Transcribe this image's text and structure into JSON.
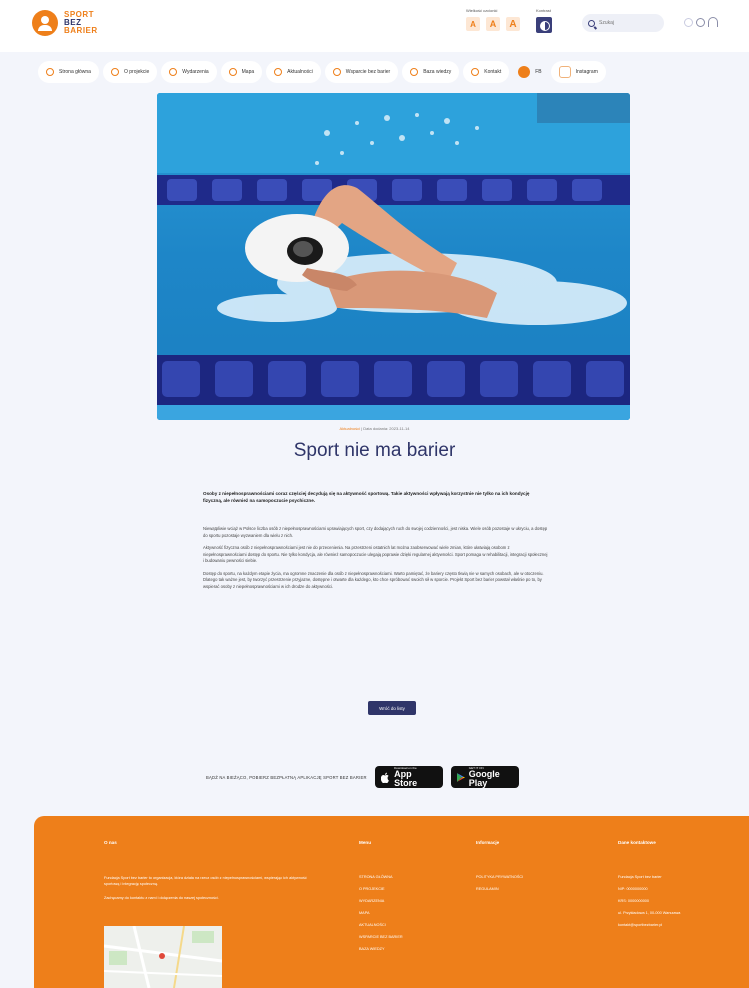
{
  "header": {
    "logo": {
      "line1": "SPORT",
      "line2": "BEZ",
      "line3": "BARIER"
    },
    "font_size_label": "Wielkość czcionki",
    "font_buttons": [
      "A",
      "A",
      "A"
    ],
    "contrast_label": "Kontrast",
    "search_placeholder": "Szukaj"
  },
  "nav": {
    "items": [
      "Strona główna",
      "O projekcie",
      "Wydarzenia",
      "Mapa",
      "Aktualności",
      "Wsparcie bez barier",
      "Baza wiedzy",
      "Kontakt",
      "FB",
      "Instagram"
    ]
  },
  "article": {
    "category": "Aktualności",
    "date": "Data dodania: 2023-11-14",
    "title": "Sport nie ma barier",
    "lead": "Osoby z niepełnosprawnościami coraz częściej decydują się na aktywność sportową. Takie aktywności wpływają korzystnie nie tylko na ich kondycję fizyczną, ale również na samopoczucie psychiczne.",
    "paragraphs": [
      "Niewątpliwie wciąż w Polsce liczba osób z niepełnosprawnościami uprawiających sport, czy dodających ruch do swojej codzienności, jest niska. Wiele osób pozostaje w ukryciu, a dostęp do sportu pozostaje wyzwaniem dla wielu z nich.",
      "Aktywność fizyczna osób z niepełnosprawnościami jest nie do przecenienia. Na przestrzeni ostatnich lat można zaobserwować wiele zmian, które ułatwiają osobom z niepełnosprawnościami dostęp do sportu. Nie tylko kondycja, ale również samopoczucie ulegają poprawie dzięki regularnej aktywności. Sport pomaga w rehabilitacji, integracji społecznej i budowaniu pewności siebie.",
      "Dostęp do sportu, na każdym etapie życia, ma ogromne znaczenie dla osób z niepełnosprawnościami. Warto pamiętać, że bariery często tkwią nie w samych osobach, ale w otoczeniu. Dlatego tak ważne jest, by tworzyć przestrzenie przyjazne, dostępne i otwarte dla każdego, kto chce spróbować swoich sił w sporcie. Projekt Sport bez barier powstał właśnie po to, by wspierać osoby z niepełnosprawnościami w ich drodze do aktywności."
    ],
    "back_button": "Wróć do listy"
  },
  "apps": {
    "text": "BĄDŹ NA BIEŻĄCO, POBIERZ BEZPŁATNĄ APLIKACJĘ SPORT BEZ BARIER",
    "apple_small": "Download on the",
    "apple_big": "App Store",
    "google_small": "GET IT ON",
    "google_big": "Google Play"
  },
  "footer": {
    "about_title": "O nas",
    "about_text_1": "Fundacja Sport bez barier to organizacja, która działa na rzecz osób z niepełnosprawnościami, wspierając ich aktywność sportową i integrację społeczną.",
    "about_text_2": "Zachęcamy do kontaktu z nami i dołączenia do naszej społeczności.",
    "menu_title": "Menu",
    "menu_items": [
      "STRONA GŁÓWNA",
      "O PROJEKCIE",
      "WYDARZENIA",
      "MAPA",
      "AKTUALNOŚCI",
      "WSPARCIE BEZ BARIER",
      "BAZA WIEDZY"
    ],
    "info_title": "Informacje",
    "info_items": [
      "POLITYKA PRYWATNOŚCI",
      "REGULAMIN"
    ],
    "contact_title": "Dane kontaktowe",
    "contact_items": [
      "Fundacja Sport bez barier",
      "NIP: 0000000000",
      "KRS: 0000000000",
      "ul. Przykładowa 1, 00-000 Warszawa",
      "kontakt@sportbezbarier.pl"
    ]
  }
}
